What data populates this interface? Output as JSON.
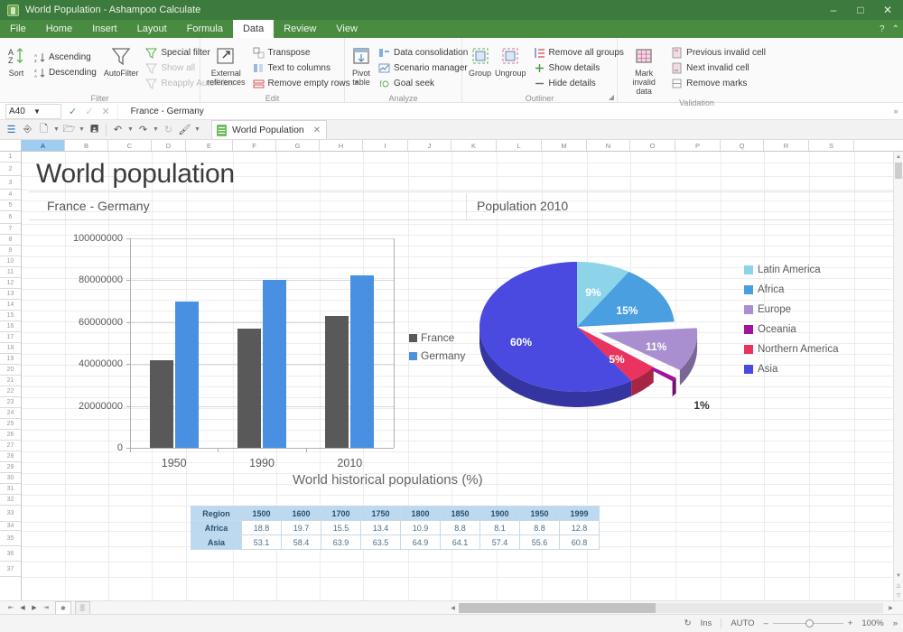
{
  "window": {
    "title": "World Population - Ashampoo Calculate",
    "minimize": "–",
    "maximize": "□",
    "close": "✕",
    "help": "?",
    "collapse": "⌃"
  },
  "menu": {
    "tabs": [
      {
        "label": "File",
        "active": false
      },
      {
        "label": "Home",
        "active": false
      },
      {
        "label": "Insert",
        "active": false
      },
      {
        "label": "Layout",
        "active": false
      },
      {
        "label": "Formula",
        "active": false
      },
      {
        "label": "Data",
        "active": true
      },
      {
        "label": "Review",
        "active": false
      },
      {
        "label": "View",
        "active": false
      }
    ]
  },
  "ribbon": {
    "groups": [
      {
        "name": "Filter",
        "label": "Filter",
        "big": [
          {
            "caption": "Sort",
            "icon": "sort-az-icon"
          }
        ],
        "cols": [
          {
            "items": [
              {
                "label": "Ascending",
                "icon": "ascending-icon",
                "disabled": false
              },
              {
                "label": "Descending",
                "icon": "descending-icon",
                "disabled": false
              }
            ]
          },
          {
            "items": [
              {
                "label": "AutoFilter",
                "icon": "funnel-icon",
                "big": true
              }
            ]
          },
          {
            "items": [
              {
                "label": "Special filter",
                "icon": "special-filter-icon",
                "disabled": false
              },
              {
                "label": "Show all",
                "icon": "show-all-icon",
                "disabled": true
              },
              {
                "label": "Reapply AutoFilter",
                "icon": "reapply-filter-icon",
                "disabled": true
              }
            ]
          }
        ]
      },
      {
        "name": "Edit",
        "label": "Edit",
        "big": [
          {
            "caption": "External references",
            "icon": "external-reference-icon"
          }
        ],
        "cols": [
          {
            "items": [
              {
                "label": "Transpose",
                "icon": "transpose-icon",
                "disabled": false
              },
              {
                "label": "Text to columns",
                "icon": "text-to-columns-icon",
                "disabled": false
              },
              {
                "label": "Remove empty rows",
                "icon": "remove-empty-rows-icon",
                "disabled": false,
                "dropdown": true
              }
            ]
          }
        ]
      },
      {
        "name": "Analyze",
        "label": "Analyze",
        "big": [
          {
            "caption": "Pivot table",
            "icon": "pivot-table-icon"
          }
        ],
        "cols": [
          {
            "items": [
              {
                "label": "Data consolidation",
                "icon": "data-consolidation-icon",
                "disabled": false
              },
              {
                "label": "Scenario manager",
                "icon": "scenario-manager-icon",
                "disabled": false
              },
              {
                "label": "Goal seek",
                "icon": "goal-seek-icon",
                "disabled": false
              }
            ]
          }
        ]
      },
      {
        "name": "Outliner",
        "label": "Outliner",
        "big": [
          {
            "caption": "Group",
            "icon": "group-icon"
          },
          {
            "caption": "Ungroup",
            "icon": "ungroup-icon"
          }
        ],
        "cols": [
          {
            "items": [
              {
                "label": "Remove all groups",
                "icon": "remove-all-groups-icon",
                "disabled": false
              },
              {
                "label": "Show details",
                "icon": "show-details-icon",
                "disabled": false
              },
              {
                "label": "Hide details",
                "icon": "hide-details-icon",
                "disabled": false
              }
            ]
          }
        ],
        "expander": "◢"
      },
      {
        "name": "Validation",
        "label": "Validation",
        "big": [
          {
            "caption": "Mark invalid data",
            "icon": "mark-invalid-data-icon"
          }
        ],
        "cols": [
          {
            "items": [
              {
                "label": "Previous invalid cell",
                "icon": "previous-invalid-cell-icon",
                "disabled": false
              },
              {
                "label": "Next invalid cell",
                "icon": "next-invalid-cell-icon",
                "disabled": false
              },
              {
                "label": "Remove marks",
                "icon": "remove-marks-icon",
                "disabled": false
              }
            ]
          }
        ]
      }
    ]
  },
  "formula_bar": {
    "name_box_value": "A40",
    "formula_value": "France - Germany",
    "accept_icon": "✓",
    "confirm_icon": "✓",
    "cancel_icon": "✕",
    "expand_icon": "»"
  },
  "quick_access": {
    "buttons": [
      "menu-icon",
      "cursor-icon",
      "new-icon",
      "open-icon",
      "save-icon",
      "undo-icon",
      "redo-icon",
      "paint-icon"
    ],
    "document_tab": {
      "label": "World Population",
      "close": "✕"
    }
  },
  "grid": {
    "columns": [
      "A",
      "B",
      "C",
      "D",
      "E",
      "F",
      "G",
      "H",
      "I",
      "J",
      "K",
      "L",
      "M",
      "N",
      "O",
      "P",
      "Q",
      "R",
      "S"
    ],
    "selected_column": "A",
    "rows": [
      1,
      2,
      3,
      4,
      5,
      6,
      7,
      8,
      9,
      10,
      11,
      12,
      13,
      14,
      15,
      16,
      17,
      18,
      19,
      20,
      21,
      22,
      23,
      24,
      25,
      26,
      27,
      28,
      29,
      30,
      31,
      32,
      33,
      34,
      35,
      36,
      37
    ]
  },
  "sheet_content": {
    "big_title": "World population",
    "subheading_left": "France - Germany",
    "subheading_right": "Population 2010",
    "table_title": "World historical populations (%)"
  },
  "chart_data": [
    {
      "type": "bar",
      "name": "france-germany-population-chart",
      "title": "France - Germany",
      "categories": [
        "1950",
        "1990",
        "2010"
      ],
      "series": [
        {
          "name": "France",
          "color": "#595959",
          "values": [
            41700000,
            56700000,
            63000000
          ]
        },
        {
          "name": "Germany",
          "color": "#4a90e2",
          "values": [
            70000000,
            80300000,
            82300000
          ]
        }
      ],
      "ylabel": "",
      "xlabel": "",
      "ylim": [
        0,
        100000000
      ],
      "yticks": [
        "0",
        "20000000",
        "40000000",
        "60000000",
        "80000000",
        "100000000"
      ],
      "grid": true,
      "legend_position": "right"
    },
    {
      "type": "pie",
      "name": "population-2010-pie-chart",
      "title": "Population 2010",
      "labels": [
        "Latin America",
        "Africa",
        "Europe",
        "Oceania",
        "Northern America",
        "Asia"
      ],
      "values": [
        9,
        15,
        11,
        1,
        5,
        60
      ],
      "value_labels": [
        "9%",
        "15%",
        "11%",
        "1%",
        "5%",
        "60%"
      ],
      "colors": [
        "#8ed4e8",
        "#4a9fe0",
        "#a98fd0",
        "#a0139b",
        "#e8345e",
        "#4a4ae0"
      ],
      "exploded": [
        "Europe",
        "Oceania"
      ],
      "legend_position": "right",
      "three_d": true
    },
    {
      "type": "table",
      "name": "world-historical-populations-table",
      "title": "World historical populations (%)",
      "columns": [
        "Region",
        "1500",
        "1600",
        "1700",
        "1750",
        "1800",
        "1850",
        "1900",
        "1950",
        "1999"
      ],
      "rows": [
        {
          "label": "Africa",
          "values": [
            "18.8",
            "19.7",
            "15.5",
            "13.4",
            "10.9",
            "8.8",
            "8.1",
            "8.8",
            "12.8"
          ]
        },
        {
          "label": "Asia",
          "values": [
            "53.1",
            "58.4",
            "63.9",
            "63.5",
            "64.9",
            "64.1",
            "57.4",
            "55.6",
            "60.8"
          ]
        }
      ]
    }
  ],
  "sheet_nav": {
    "buttons": [
      "first-sheet",
      "previous-sheet",
      "next-sheet",
      "last-sheet"
    ],
    "glyphs": [
      "⇤",
      "◀",
      "▶",
      "⇥"
    ],
    "tabs": [
      "✱",
      "▒"
    ]
  },
  "statusbar": {
    "refresh_icon": "↻",
    "insert_mode": "Ins",
    "calc_mode": "AUTO",
    "zoom_minus": "–",
    "zoom_plus": "+",
    "zoom_level": "100%",
    "expand": "»"
  },
  "colors": {
    "title_bar": "#3d7a3d",
    "menu_bar": "#4a8b42",
    "accent": "#4a90e2",
    "france_bar": "#595959",
    "germany_bar": "#4a90e2",
    "header_select": "#9ecdf0"
  }
}
